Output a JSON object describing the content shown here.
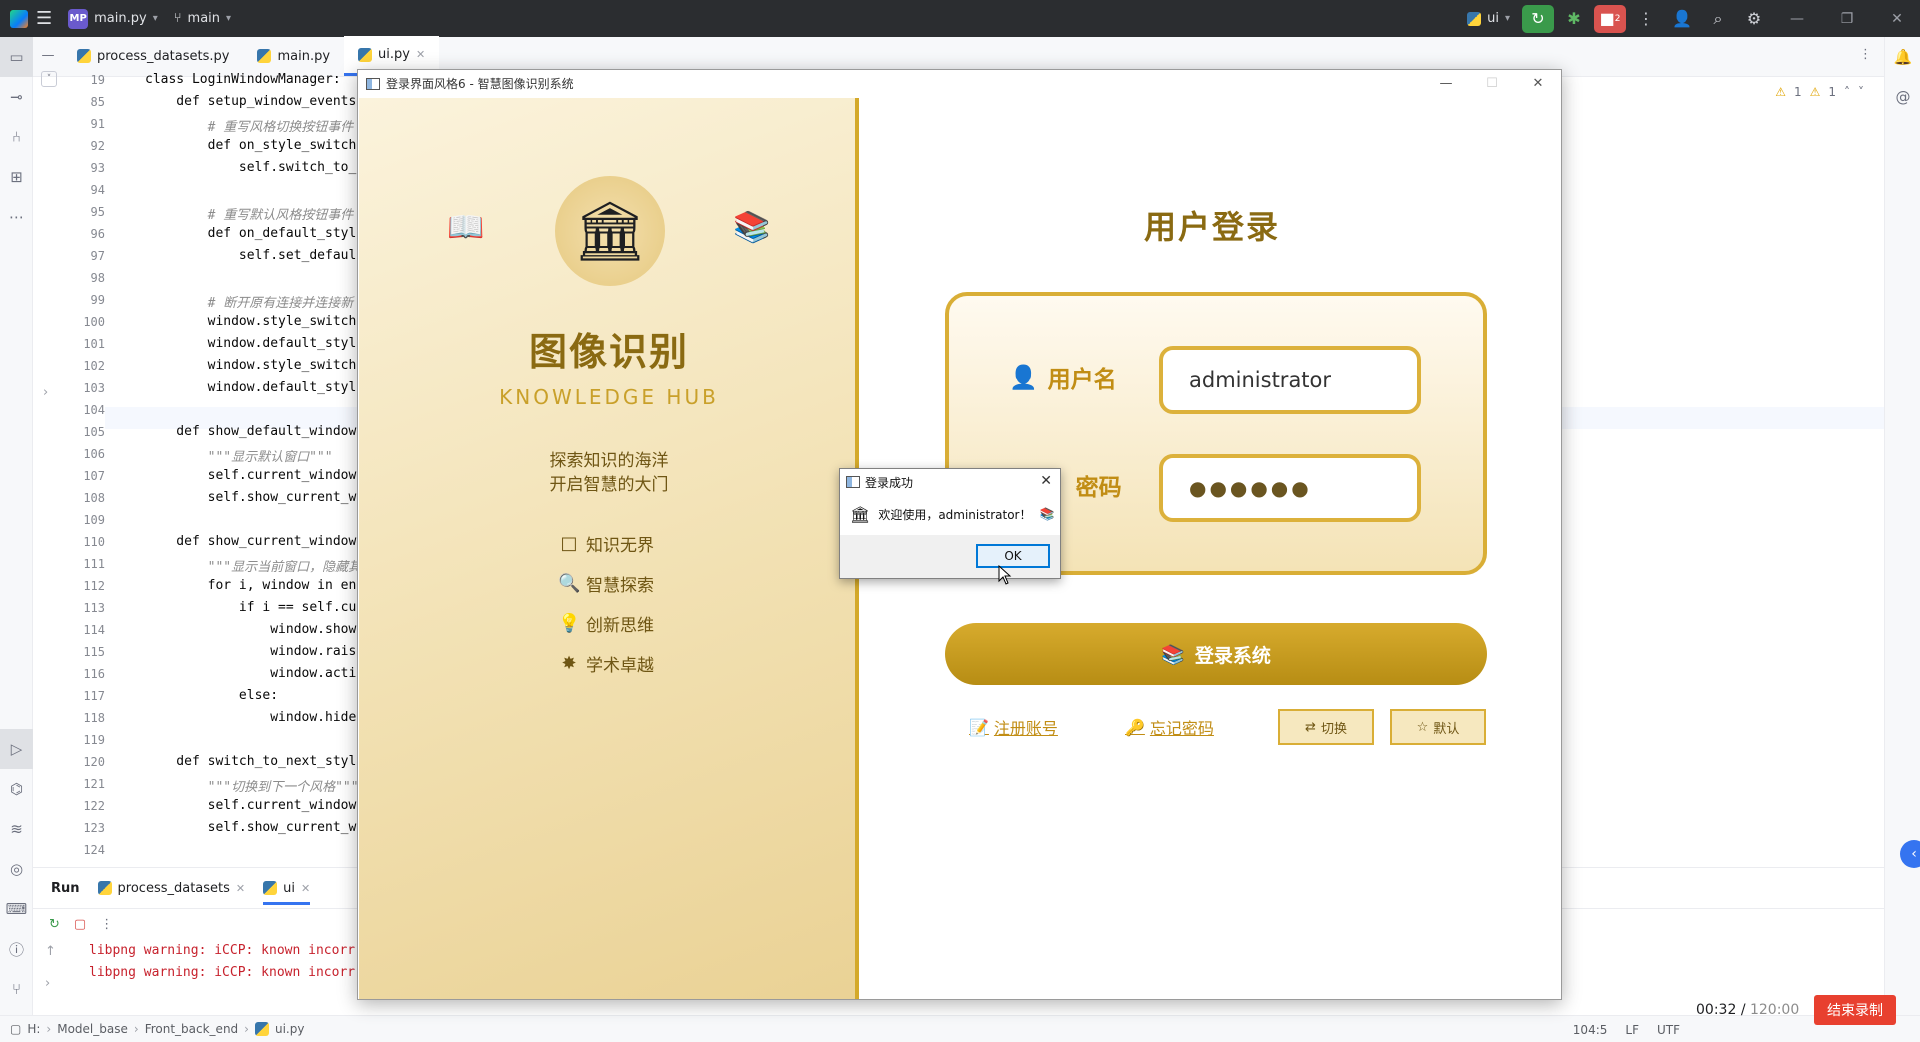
{
  "topbar": {
    "project_badge": "MP",
    "project": "main.py",
    "branch": "main",
    "interpreter": "ui",
    "run_badge": "2"
  },
  "tabs": [
    {
      "label": "process_datasets.py"
    },
    {
      "label": "main.py"
    },
    {
      "label": "ui.py"
    }
  ],
  "inspections": {
    "warnings": "1",
    "weak": "1"
  },
  "editor": {
    "lines": [
      {
        "n": "19",
        "code": "class LoginWindowManager:"
      },
      {
        "n": "85",
        "code": "    def setup_window_events"
      },
      {
        "n": "91",
        "code": "        # 重写风格切换按钮事件"
      },
      {
        "n": "92",
        "code": "        def on_style_switch"
      },
      {
        "n": "93",
        "code": "            self.switch_to_"
      },
      {
        "n": "94",
        "code": ""
      },
      {
        "n": "95",
        "code": "        # 重写默认风格按钮事件"
      },
      {
        "n": "96",
        "code": "        def on_default_styl"
      },
      {
        "n": "97",
        "code": "            self.set_defaul"
      },
      {
        "n": "98",
        "code": ""
      },
      {
        "n": "99",
        "code": "        # 断开原有连接并连接新"
      },
      {
        "n": "100",
        "code": "        window.style_switch"
      },
      {
        "n": "101",
        "code": "        window.default_styl"
      },
      {
        "n": "102",
        "code": "        window.style_switch"
      },
      {
        "n": "103",
        "code": "        window.default_styl"
      },
      {
        "n": "104",
        "code": ""
      },
      {
        "n": "105",
        "code": "    def show_default_window"
      },
      {
        "n": "106",
        "code": "        \"\"\"显示默认窗口\"\"\""
      },
      {
        "n": "107",
        "code": "        self.current_window"
      },
      {
        "n": "108",
        "code": "        self.show_current_w"
      },
      {
        "n": "109",
        "code": ""
      },
      {
        "n": "110",
        "code": "    def show_current_window"
      },
      {
        "n": "111",
        "code": "        \"\"\"显示当前窗口，隐藏其"
      },
      {
        "n": "112",
        "code": "        for i, window in en"
      },
      {
        "n": "113",
        "code": "            if i == self.cu"
      },
      {
        "n": "114",
        "code": "                window.show"
      },
      {
        "n": "115",
        "code": "                window.rais"
      },
      {
        "n": "116",
        "code": "                window.acti"
      },
      {
        "n": "117",
        "code": "            else:"
      },
      {
        "n": "118",
        "code": "                window.hide"
      },
      {
        "n": "119",
        "code": ""
      },
      {
        "n": "120",
        "code": "    def switch_to_next_styl"
      },
      {
        "n": "121",
        "code": "        \"\"\"切换到下一个风格\"\"\""
      },
      {
        "n": "122",
        "code": "        self.current_window"
      },
      {
        "n": "123",
        "code": "        self.show_current_w"
      },
      {
        "n": "124",
        "code": ""
      }
    ]
  },
  "run": {
    "label": "Run",
    "tabs": [
      {
        "label": "process_datasets"
      },
      {
        "label": "ui"
      }
    ],
    "console": [
      "libpng warning: iCCP: known incorr",
      "libpng warning: iCCP: known incorr"
    ]
  },
  "status": {
    "crumbs": [
      "H:",
      "Model_base",
      "Front_back_end",
      "ui.py"
    ],
    "position": "104:5",
    "line_sep": "LF",
    "encoding": "UTF"
  },
  "recording": {
    "elapsed": "00:32",
    "separator": "/",
    "total": "120:00",
    "stop_label": "结束录制"
  },
  "app": {
    "window_title": "登录界面风格6 - 智慧图像识别系统",
    "brand_title": "图像识别",
    "brand_subtitle": "KNOWLEDGE HUB",
    "slogan_1": "探索知识的海洋",
    "slogan_2": "开启智慧的大门",
    "features": [
      {
        "icon": "□",
        "label": "知识无界"
      },
      {
        "icon": "🔍",
        "label": "智慧探索"
      },
      {
        "icon": "💡",
        "label": "创新思维"
      },
      {
        "icon": "✸",
        "label": "学术卓越"
      }
    ],
    "login_title": "用户登录",
    "username_label": "用户名",
    "username_value": "administrator",
    "password_label": "密码",
    "password_value": "●●●●●●",
    "login_button": "登录系统",
    "register_link": "注册账号",
    "forgot_link": "忘记密码",
    "switch_button": "切换",
    "default_button": "默认"
  },
  "dialog": {
    "title": "登录成功",
    "message": "欢迎使用，administrator！",
    "ok_label": "OK"
  },
  "colors": {
    "gold_dark": "#8a6a12",
    "gold": "#d9ae36",
    "ide_dark": "#2b2d30",
    "record_red": "#e8402f"
  }
}
